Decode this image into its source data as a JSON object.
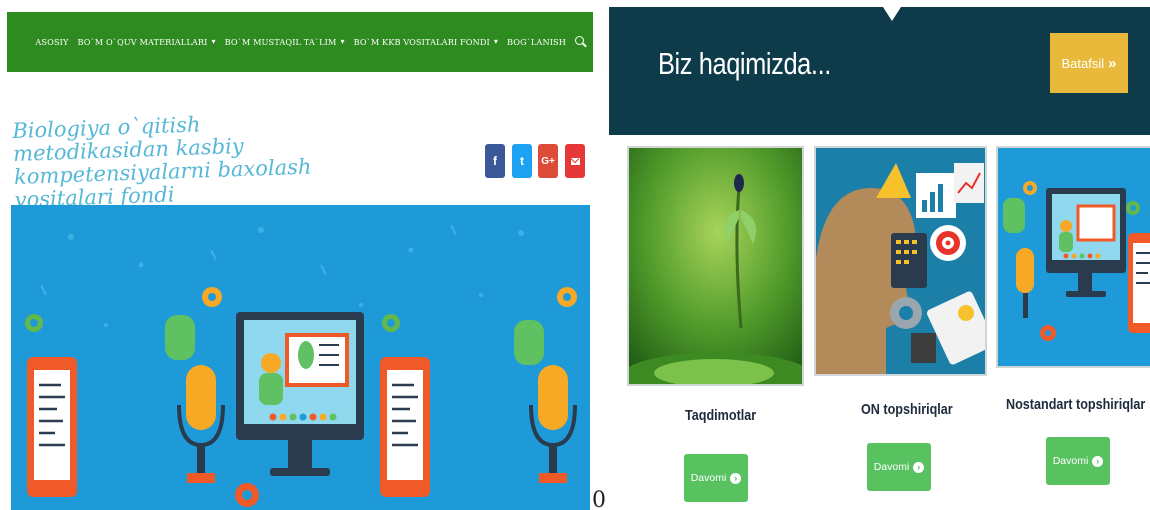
{
  "nav": {
    "items": [
      {
        "label": "ASOSIY",
        "dropdown": false
      },
      {
        "label": "BO`M O`QUV MATERIALLARI",
        "dropdown": true
      },
      {
        "label": "BO`M MUSTAQIL TA`LIM",
        "dropdown": true
      },
      {
        "label": "BO`M KKB VOSITALARI FONDI",
        "dropdown": true
      },
      {
        "label": "BOG`LANISH",
        "dropdown": false
      }
    ],
    "search_icon": "search-icon",
    "caret": "▾"
  },
  "site": {
    "title_line1": "Biologiya o`qitish metodikasidan kasbiy",
    "title_line2": "kompetensiyalarni baxolash vositalari fondi"
  },
  "social": {
    "facebook": "f",
    "twitter": "t",
    "googleplus": "G+"
  },
  "stray_char": "0",
  "about": {
    "title": "Biz haqimizda...",
    "button": "Batafsil",
    "button_icon": "»"
  },
  "cards": [
    {
      "title": "Taqdimotlar",
      "button": "Davomi"
    },
    {
      "title": "ON topshiriqlar",
      "button": "Davomi"
    },
    {
      "title": "Nostandart topshiriqlar",
      "button": "Davomi"
    }
  ],
  "colors": {
    "nav_bg": "#2e8b1f",
    "title_color": "#55b8d6",
    "hero_bg": "#1e9ad8",
    "about_bg": "#0e3b4a",
    "about_button": "#e8b93a",
    "davomi_button": "#58c160"
  }
}
